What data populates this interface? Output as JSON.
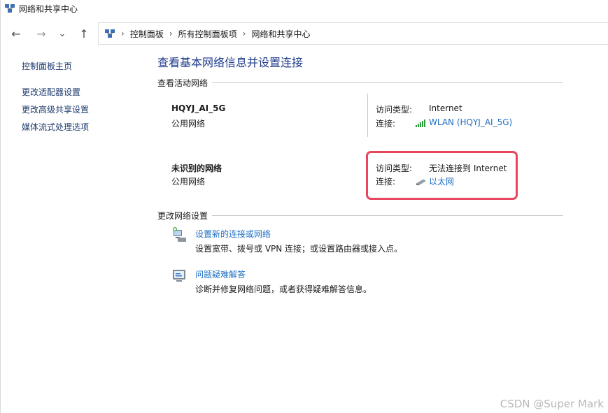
{
  "window": {
    "title": "网络和共享中心"
  },
  "nav": {
    "back_icon": "←",
    "forward_icon": "→",
    "dropdown_icon": "⌄",
    "up_icon": "↑",
    "sep": "›",
    "breadcrumbs": [
      "控制面板",
      "所有控制面板项",
      "网络和共享中心"
    ]
  },
  "sidebar": {
    "home": "控制面板主页",
    "items": [
      "更改适配器设置",
      "更改高级共享设置",
      "媒体流式处理选项"
    ]
  },
  "main": {
    "title": "查看基本网络信息并设置连接",
    "active_networks_heading": "查看活动网络",
    "change_settings_heading": "更改网络设置",
    "networks": [
      {
        "name": "HQYJ_AI_5G",
        "type": "公用网络",
        "access_label": "访问类型:",
        "access_value": "Internet",
        "connection_label": "连接:",
        "connection_value": "WLAN (HQYJ_AI_5G)",
        "connection_icon": "wifi-signal-icon"
      },
      {
        "name": "未识别的网络",
        "type": "公用网络",
        "access_label": "访问类型:",
        "access_value": "无法连接到 Internet",
        "connection_label": "连接:",
        "connection_value": "以太网",
        "connection_icon": "ethernet-icon"
      }
    ],
    "tasks": [
      {
        "icon": "new-connection-icon",
        "label": "设置新的连接或网络",
        "desc": "设置宽带、拨号或 VPN 连接；或设置路由器或接入点。"
      },
      {
        "icon": "troubleshoot-icon",
        "label": "问题疑难解答",
        "desc": "诊断并修复网络问题，或者获得疑难解答信息。"
      }
    ]
  },
  "colors": {
    "link": "#1f6fc4",
    "title": "#1e3a8a",
    "highlight": "#e8465f"
  },
  "watermark": "CSDN @Super Mark"
}
